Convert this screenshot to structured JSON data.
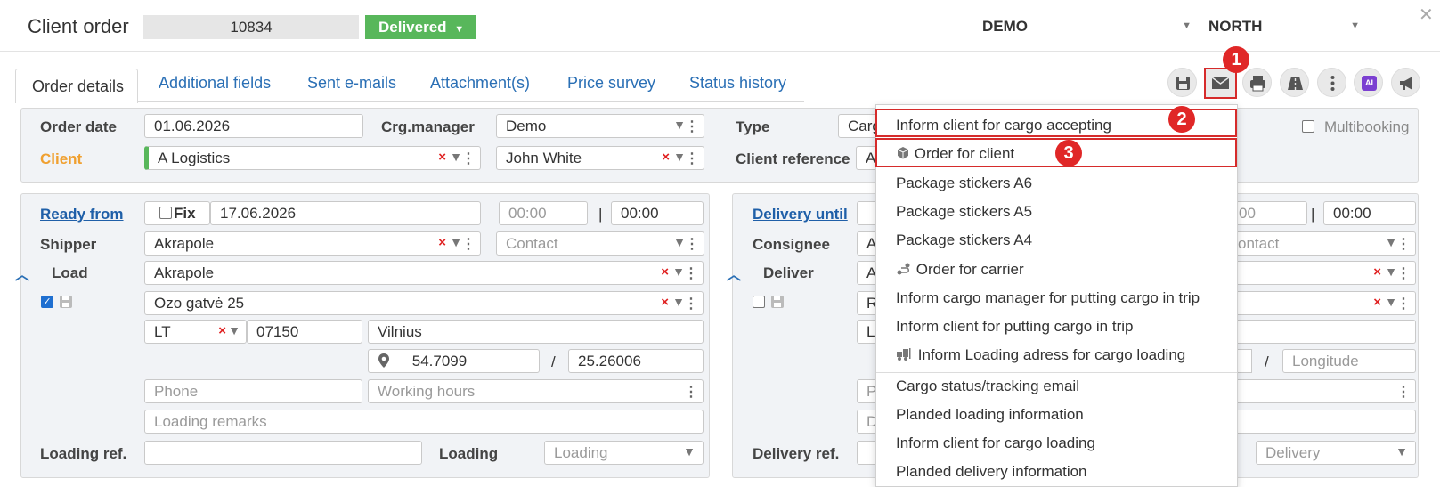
{
  "header": {
    "title": "Client order",
    "order_number": "10834",
    "status": "Delivered",
    "company": "DEMO",
    "region": "NORTH"
  },
  "tabs": [
    {
      "label": "Order details"
    },
    {
      "label": "Additional fields"
    },
    {
      "label": "Sent e-mails"
    },
    {
      "label": "Attachment(s)"
    },
    {
      "label": "Price survey"
    },
    {
      "label": "Status history"
    }
  ],
  "toolbar": {
    "ai_label": "AI"
  },
  "top_form": {
    "order_date_label": "Order date",
    "order_date": "01.06.2026",
    "cargo_manager_label": "Crg.manager",
    "cargo_manager": "Demo",
    "type_label": "Type",
    "type_value": "Carg",
    "multibooking_label": "Multibooking",
    "client_label": "Client",
    "client_value": "A Logistics",
    "contact_value": "John White",
    "client_ref_label": "Client reference",
    "client_ref_value": "A"
  },
  "left": {
    "ready_from_label": "Ready from",
    "fix_label": "Fix",
    "ready_date": "17.06.2026",
    "time_from_ph": "00:00",
    "time_sep": "|",
    "time_to": "00:00",
    "shipper_label": "Shipper",
    "shipper_value": "Akrapole",
    "contact_ph": "Contact",
    "load_label": "Load",
    "load_value": "Akrapole",
    "address": "Ozo gatvė 25",
    "country": "LT",
    "postcode": "07150",
    "city": "Vilnius",
    "latitude": "54.7099",
    "coord_sep": "/",
    "longitude": "25.26006",
    "phone_ph": "Phone",
    "working_hours_ph": "Working hours",
    "loading_remarks_ph": "Loading remarks",
    "loading_ref_label": "Loading ref.",
    "loading_label": "Loading",
    "loading_ph": "Loading"
  },
  "right": {
    "delivery_until_label": "Delivery until",
    "time_from_partial": "00",
    "time_sep": "|",
    "time_to": "00:00",
    "consignee_label": "Consignee",
    "consignee_partial": "A",
    "contact_partial": "ontact",
    "deliver_label": "Deliver",
    "deliver_partial": "A",
    "addr_partial": "R",
    "country_partial": "L",
    "coord_sep": "/",
    "longitude_ph": "Longitude",
    "phone_partial": "P",
    "remarks_partial": "D",
    "delivery_ref_label": "Delivery ref.",
    "delivery_ph": "Delivery"
  },
  "menu": {
    "items": [
      {
        "label": "Inform client for cargo accepting"
      },
      {
        "label": "Order for client"
      },
      {
        "label": "Package stickers A6"
      },
      {
        "label": "Package stickers A5"
      },
      {
        "label": "Package stickers A4"
      },
      {
        "label": "Order for carrier"
      },
      {
        "label": "Inform cargo manager for putting cargo in trip"
      },
      {
        "label": "Inform client for putting cargo in trip"
      },
      {
        "label": "Inform Loading adress for cargo loading"
      },
      {
        "label": "Cargo status/tracking email"
      },
      {
        "label": "Planded loading information"
      },
      {
        "label": "Inform client for cargo loading"
      },
      {
        "label": "Planded delivery information"
      }
    ]
  },
  "annotations": {
    "step1": "1",
    "step2": "2",
    "step3": "3"
  },
  "colors": {
    "status_green": "#58b75b",
    "link_blue": "#2a6fb5",
    "annotation_red": "#d62b2b",
    "client_orange": "#f0a030"
  }
}
